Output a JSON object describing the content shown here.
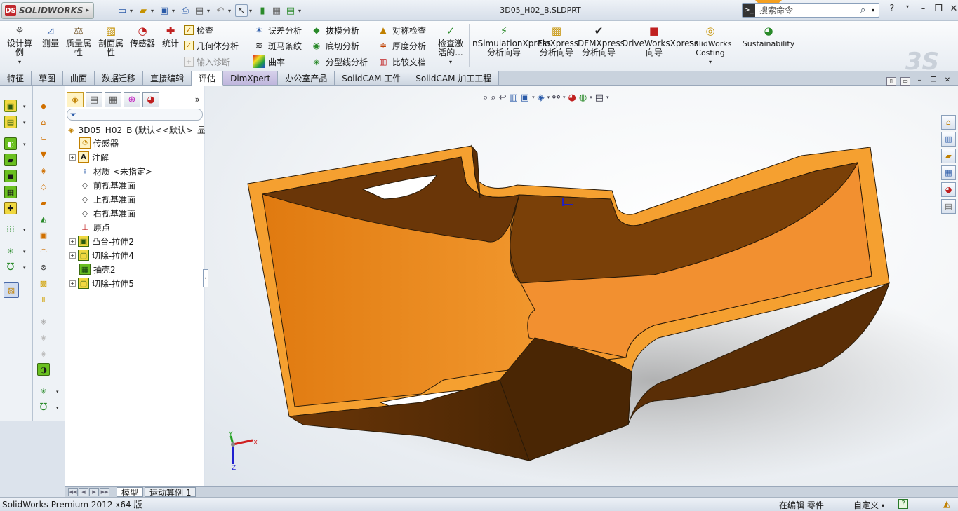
{
  "titlebar": {
    "app_name": "SOLIDWORKS",
    "document_title": "3D05_H02_B.SLDPRT",
    "search_placeholder": "搜索命令",
    "help_label": "?"
  },
  "command_manager": {
    "design_study": "设计算例",
    "measure": "测量",
    "mass_properties": "质量属性",
    "section_properties": "剖面属性",
    "sensors": "传感器",
    "statistics": "统计",
    "check": "检查",
    "geometry_analysis": "几何体分析",
    "import_diagnostics": "输入诊断",
    "deviation_analysis": "误差分析",
    "zebra_stripes": "斑马条纹",
    "curvature": "曲率",
    "draft_analysis": "拔模分析",
    "undercut_analysis": "底切分析",
    "parting_line_analysis": "分型线分析",
    "symmetry_check": "对称检查",
    "thickness_analysis": "厚度分析",
    "compare_documents": "比较文档",
    "check_active": "检查激活的...",
    "simxpress": "nSimulationXpress 分析向导",
    "floxpress": "FloXpress 分析向导",
    "dfmxpress": "DFMXpress 分析向导",
    "driveworksxpress": "DriveWorksXpress 向导",
    "costing": "SolidWorks Costing",
    "sustainability": "Sustainability"
  },
  "tabs": [
    "特征",
    "草图",
    "曲面",
    "数据迁移",
    "直接编辑",
    "评估",
    "DimXpert",
    "办公室产品",
    "SolidCAM 工件",
    "SolidCAM 加工工程"
  ],
  "active_tab_index": 5,
  "feature_tree": {
    "root": "3D05_H02_B (默认<<默认>_显",
    "items": [
      {
        "label": "传感器",
        "icon": "sensor-icon",
        "expandable": false
      },
      {
        "label": "注解",
        "icon": "annotation-icon",
        "expandable": true
      },
      {
        "label": "材质 <未指定>",
        "icon": "material-icon",
        "expandable": false
      },
      {
        "label": "前视基准面",
        "icon": "plane-icon",
        "expandable": false
      },
      {
        "label": "上视基准面",
        "icon": "plane-icon",
        "expandable": false
      },
      {
        "label": "右视基准面",
        "icon": "plane-icon",
        "expandable": false
      },
      {
        "label": "原点",
        "icon": "origin-icon",
        "expandable": false
      },
      {
        "label": "凸台-拉伸2",
        "icon": "extrude-icon",
        "expandable": true
      },
      {
        "label": "切除-拉伸4",
        "icon": "cut-extrude-icon",
        "expandable": true
      },
      {
        "label": "抽壳2",
        "icon": "shell-icon",
        "expandable": false
      },
      {
        "label": "切除-拉伸5",
        "icon": "cut-extrude-icon",
        "expandable": true
      }
    ]
  },
  "bottom_tabs": [
    "模型",
    "运动算例 1"
  ],
  "statusbar": {
    "product": "SolidWorks Premium 2012 x64 版",
    "editing": "在编辑 零件",
    "custom": "自定义"
  },
  "colors": {
    "part": "#f08a1c",
    "part_dark": "#6a3608",
    "accent": "#2a5aa8"
  },
  "axes": {
    "x": "X",
    "y": "Y",
    "z": "Z"
  }
}
